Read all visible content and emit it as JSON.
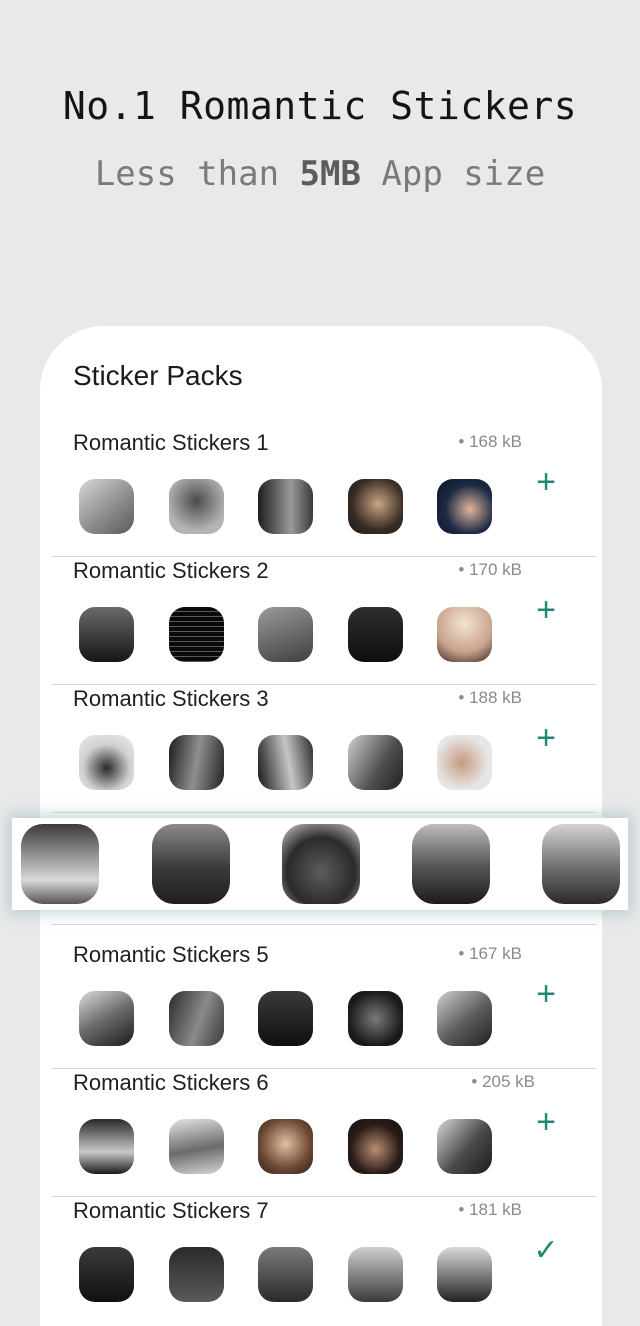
{
  "promo": {
    "headline": "No.1 Romantic Stickers",
    "sub_pre": "Less than ",
    "sub_bold": "5MB",
    "sub_post": " App size"
  },
  "card": {
    "title": "Sticker Packs"
  },
  "packs": [
    {
      "name": "Romantic Stickers 1",
      "size": "• 168 kB",
      "action": "+"
    },
    {
      "name": "Romantic Stickers 2",
      "size": "• 170 kB",
      "action": "+"
    },
    {
      "name": "Romantic Stickers 3",
      "size": "• 188 kB",
      "action": "+"
    },
    {
      "name": "Romantic Stickers 5",
      "size": "• 167 kB",
      "action": "+"
    },
    {
      "name": "Romantic Stickers 6",
      "size": "• 205 kB",
      "action": "+"
    },
    {
      "name": "Romantic Stickers 7",
      "size": "• 181 kB",
      "action": "✓"
    }
  ],
  "colors": {
    "accent": "#1f8a74",
    "background": "#e9e9e9",
    "card": "#ffffff"
  }
}
